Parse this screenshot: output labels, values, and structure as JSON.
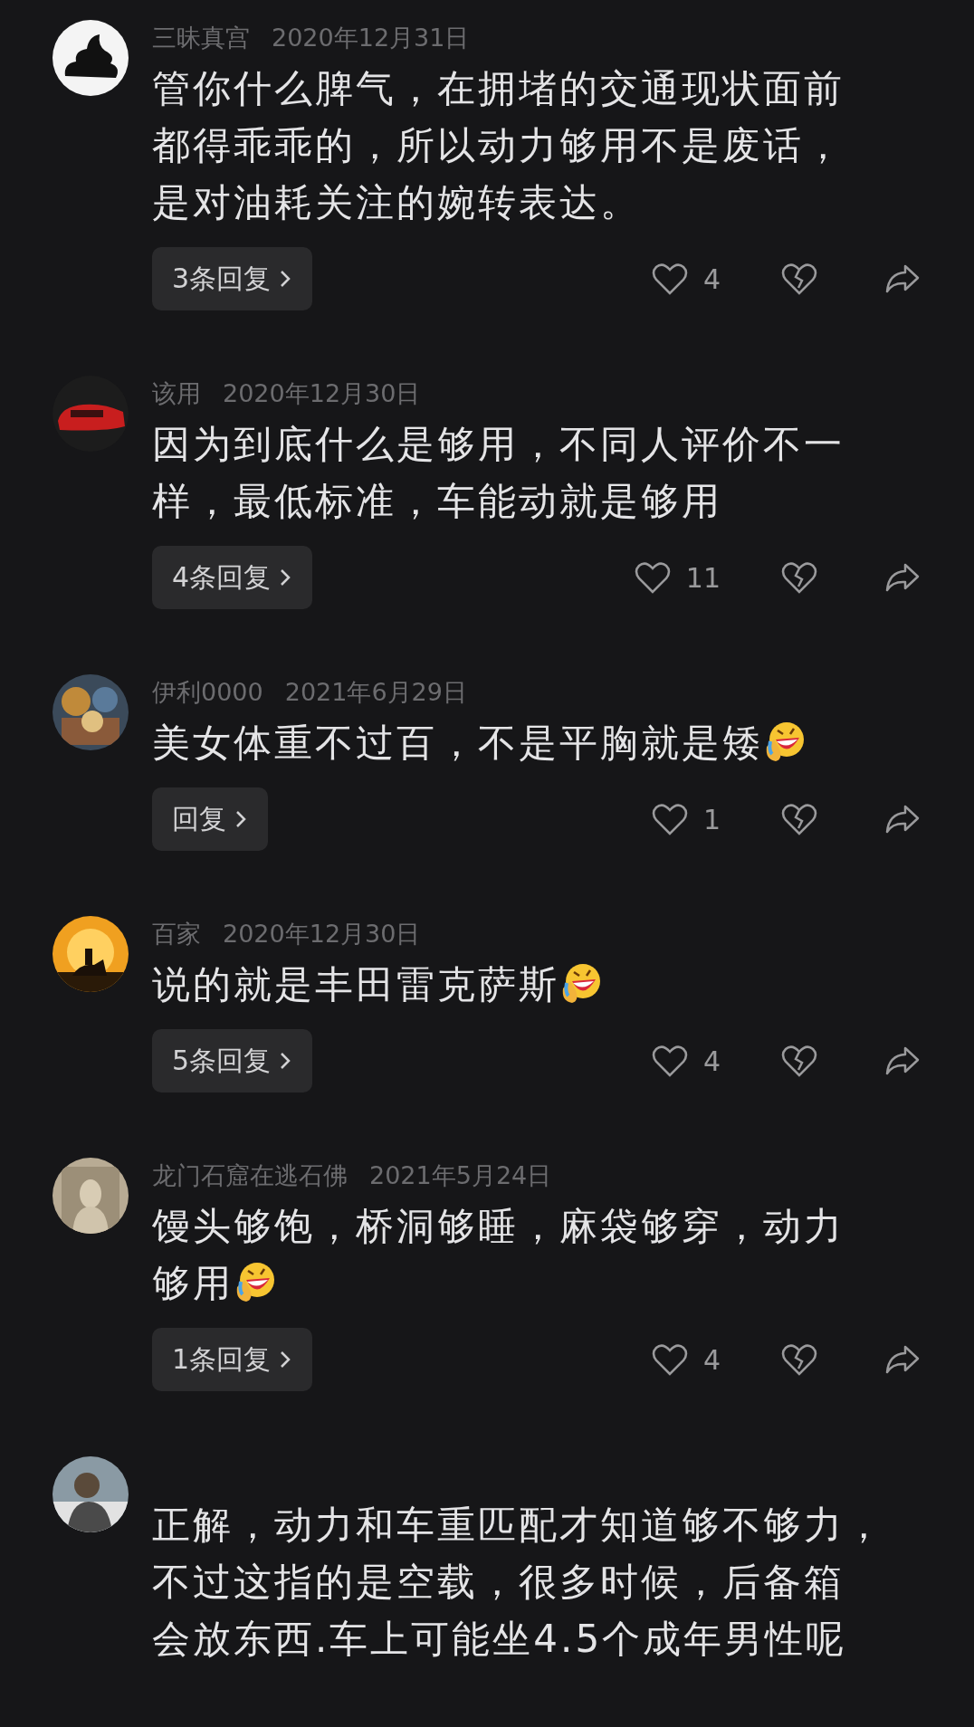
{
  "comments": [
    {
      "name": "三昧真宫",
      "date": "2020年12月31日",
      "text": [
        "管你什么脾气，在拥堵的交通现状面前",
        "都得乖乖的，所以动力够用不是废话，",
        "是对油耗关注的婉转表达。"
      ],
      "emoji": false,
      "reply_label": "3条回复",
      "likes": "4"
    },
    {
      "name": "该用",
      "date": "2020年12月30日",
      "text": [
        "因为到底什么是够用，不同人评价不一",
        "样，最低标准，车能动就是够用"
      ],
      "emoji": false,
      "reply_label": "4条回复",
      "likes": "11"
    },
    {
      "name": "伊利0000",
      "date": "2021年6月29日",
      "text": [
        "美女体重不过百，不是平胸就是矮"
      ],
      "emoji": true,
      "reply_label": "回复",
      "likes": "1"
    },
    {
      "name": "百家",
      "date": "2020年12月30日",
      "text": [
        "说的就是丰田雷克萨斯"
      ],
      "emoji": true,
      "reply_label": "5条回复",
      "likes": "4"
    },
    {
      "name": "龙门石窟在逃石佛",
      "date": "2021年5月24日",
      "text": [
        "馒头够饱，桥洞够睡，麻袋够穿，动力",
        "够用"
      ],
      "emoji": true,
      "reply_label": "1条回复",
      "likes": "4"
    },
    {
      "text": [
        "正解，动力和车重匹配才知道够不够力，",
        "不过这指的是空载，很多时候，后备箱",
        "会放东西.车上可能坐4.5个成年男性呢"
      ],
      "emoji": false
    }
  ]
}
